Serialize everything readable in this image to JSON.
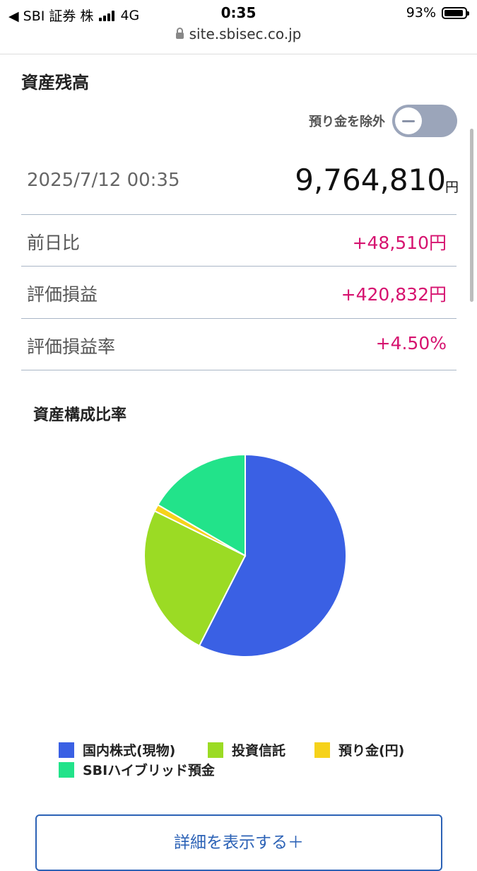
{
  "status_bar": {
    "back_app": "◀ SBI 証券 株",
    "network": "4G",
    "time": "0:35",
    "battery": "93%"
  },
  "browser": {
    "url": "site.sbisec.co.jp"
  },
  "balance": {
    "title": "資産残高",
    "toggle_label": "預り金を除外",
    "toggle_on": false,
    "as_of": "2025/7/12 00:35",
    "total": "9,764,810",
    "total_unit": "円",
    "rows": [
      {
        "label": "前日比",
        "value": "+48,510円"
      },
      {
        "label": "評価損益",
        "value": "+420,832円"
      },
      {
        "label": "評価損益率",
        "value": "+4.50%"
      }
    ]
  },
  "composition": {
    "title": "資産構成比率",
    "button_label": "詳細を表示する＋"
  },
  "chart_data": {
    "type": "pie",
    "categories": [
      "国内株式(現物)",
      "投資信託",
      "預り金(円)",
      "SBIハイブリッド預金"
    ],
    "values": [
      57.5,
      24.8,
      1.1,
      16.6
    ],
    "colors": [
      "#3a60e4",
      "#9bdb24",
      "#f6d21a",
      "#22e38a"
    ],
    "legend_position": "bottom"
  },
  "colors": {
    "positive": "#d6126f",
    "accent": "#2c62b6",
    "toggle_off": "#9ba5ba"
  }
}
